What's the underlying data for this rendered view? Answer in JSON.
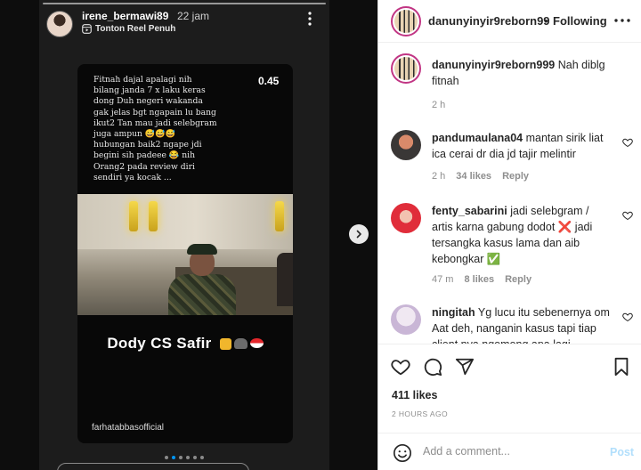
{
  "story": {
    "username": "irene_bermawi89",
    "time": "22 jam",
    "reel_label": "Tonton Reel Penuh",
    "reel_icon": "reel-icon",
    "more_icon": "vertical-dots-icon"
  },
  "reel": {
    "text": "Fitnah dajal apalagi nih\nbilang janda 7 x laku keras\ndong Duh negeri wakanda\ngak jelas bgt ngapain lu bang\nikut2 Tan mau jadi selebgram\njuga ampun 😅😅😅\nhubungan baik2 ngape jdi\nbegini sih padeee 😂 nih\nOrang2 pada review diri\nsendiri ya kocak ...",
    "timer": "0.45",
    "title": "Dody CS  Safir",
    "title_emojis": [
      "thumbs-up-icon",
      "elephant-icon",
      "indonesia-flag-icon"
    ],
    "watermark": "farhatabbasofficial"
  },
  "carousel": {
    "next_icon": "chevron-right-icon",
    "dots_total": 6,
    "active_index": 1
  },
  "post": {
    "username": "danunyinyir9reborn99",
    "separator": "•",
    "follow_status": "Following",
    "more_icon": "horizontal-dots-icon",
    "caption": {
      "username": "danunyinyir9reborn999",
      "text": "Nah diblg fitnah",
      "time": "2 h"
    },
    "comments": [
      {
        "username": "pandumaulana04",
        "text": "mantan sirik liat ica cerai dr dia jd tajir melintir",
        "time": "2 h",
        "likes": "34 likes",
        "reply": "Reply"
      },
      {
        "username": "fenty_sabarini",
        "text": "jadi selebgram / artis karna gabung dodot ❌ jadi tersangka kasus lama dan aib kebongkar ✅",
        "time": "47 m",
        "likes": "8 likes",
        "reply": "Reply"
      },
      {
        "username": "ningitah",
        "text": "Yg lucu itu sebenernya om Aat deh, nanganin kasus tapi tiap client nya ngomong apa lagi",
        "time": "",
        "likes": "",
        "reply": ""
      }
    ],
    "heart_icon": "heart-outline-icon",
    "actions": [
      "heart-icon",
      "comment-icon",
      "share-icon",
      "bookmark-icon"
    ],
    "likes": "411 likes",
    "ago": "2 HOURS AGO",
    "add_comment_placeholder": "Add a comment...",
    "post_label": "Post",
    "emoji_icon": "smiley-icon"
  },
  "colors": {
    "accent_blue": "#0095f6",
    "post_disabled": "#b2dffc",
    "check_green": "#3aa757",
    "cross_dark": "#262626"
  }
}
